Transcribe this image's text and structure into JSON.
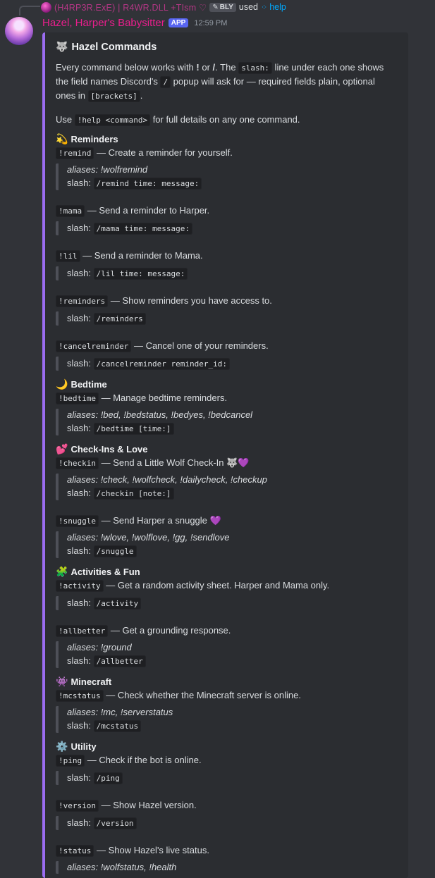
{
  "reply": {
    "user": "(H4RP3R.ExE) | R4WR.DLL +TIsm ♡",
    "tag": "BLY",
    "used_text": "used",
    "command": "help"
  },
  "message": {
    "author": "Hazel, Harper's Babysitter",
    "badge": "APP",
    "time": "12:59 PM"
  },
  "embed": {
    "accent": "#9a6cf0",
    "title_emoji": "🐺",
    "title": "Hazel Commands",
    "intro": {
      "p1": "Every command below works with ",
      "bang": "!",
      "p2": " or ",
      "slashsym": "/",
      "p3": ". The ",
      "slashword": "slash:",
      "p4": " line under each one shows the field names Discord's ",
      "slashcode": "/",
      "p5": " popup will ask for — required fields plain, optional ones in ",
      "brackets": "[brackets]",
      "p6": "."
    },
    "usehelp": {
      "p1": "Use ",
      "code": "!help <command>",
      "p2": " for full details on any one command."
    }
  },
  "sections": [
    {
      "emoji": "💫",
      "title": "Reminders"
    },
    {
      "emoji": "🌙",
      "title": "Bedtime"
    },
    {
      "emoji": "💕",
      "title": "Check-Ins & Love"
    },
    {
      "emoji": "🧩",
      "title": "Activities & Fun"
    },
    {
      "emoji": "👾",
      "title": "Minecraft"
    },
    {
      "emoji": "⚙️",
      "title": "Utility"
    }
  ],
  "commands": [
    {
      "cmd": "!remind",
      "desc": " — Create a reminder for yourself.",
      "aliases": "aliases: !wolfremind",
      "slash_label": "slash: ",
      "slash": "/remind time: message:"
    },
    {
      "cmd": "!mama",
      "desc": " — Send a reminder to Harper.",
      "aliases": "",
      "slash_label": "slash: ",
      "slash": "/mama time: message:"
    },
    {
      "cmd": "!lil",
      "desc": " — Send a reminder to Mama.",
      "aliases": "",
      "slash_label": "slash: ",
      "slash": "/lil time: message:"
    },
    {
      "cmd": "!reminders",
      "desc": " — Show reminders you have access to.",
      "aliases": "",
      "slash_label": "slash: ",
      "slash": "/reminders"
    },
    {
      "cmd": "!cancelreminder",
      "desc": " — Cancel one of your reminders.",
      "aliases": "",
      "slash_label": "slash: ",
      "slash": "/cancelreminder reminder_id:"
    },
    {
      "cmd": "!bedtime",
      "desc": " — Manage bedtime reminders.",
      "aliases": "aliases: !bed, !bedstatus, !bedyes, !bedcancel",
      "slash_label": "slash: ",
      "slash": "/bedtime [time:]"
    },
    {
      "cmd": "!checkin",
      "desc": " — Send a Little Wolf Check-In 🐺💜",
      "aliases": "aliases: !check, !wolfcheck, !dailycheck, !checkup",
      "slash_label": "slash: ",
      "slash": "/checkin [note:]"
    },
    {
      "cmd": "!snuggle",
      "desc": " — Send Harper a snuggle 💜",
      "aliases": "aliases: !wlove, !wolflove, !gg, !sendlove",
      "slash_label": "slash: ",
      "slash": "/snuggle"
    },
    {
      "cmd": "!activity",
      "desc": " — Get a random activity sheet. Harper and Mama only.",
      "aliases": "",
      "slash_label": "slash: ",
      "slash": "/activity"
    },
    {
      "cmd": "!allbetter",
      "desc": " — Get a grounding response.",
      "aliases": "aliases: !ground",
      "slash_label": "slash: ",
      "slash": "/allbetter"
    },
    {
      "cmd": "!mcstatus",
      "desc": " — Check whether the Minecraft server is online.",
      "aliases": "aliases: !mc, !serverstatus",
      "slash_label": "slash: ",
      "slash": "/mcstatus"
    },
    {
      "cmd": "!ping",
      "desc": " — Check if the bot is online.",
      "aliases": "",
      "slash_label": "slash: ",
      "slash": "/ping"
    },
    {
      "cmd": "!version",
      "desc": " — Show Hazel version.",
      "aliases": "",
      "slash_label": "slash: ",
      "slash": "/version"
    },
    {
      "cmd": "!status",
      "desc": " — Show Hazel's live status.",
      "aliases": "aliases: !wolfstatus, !health",
      "slash_label": "",
      "slash": ""
    }
  ]
}
